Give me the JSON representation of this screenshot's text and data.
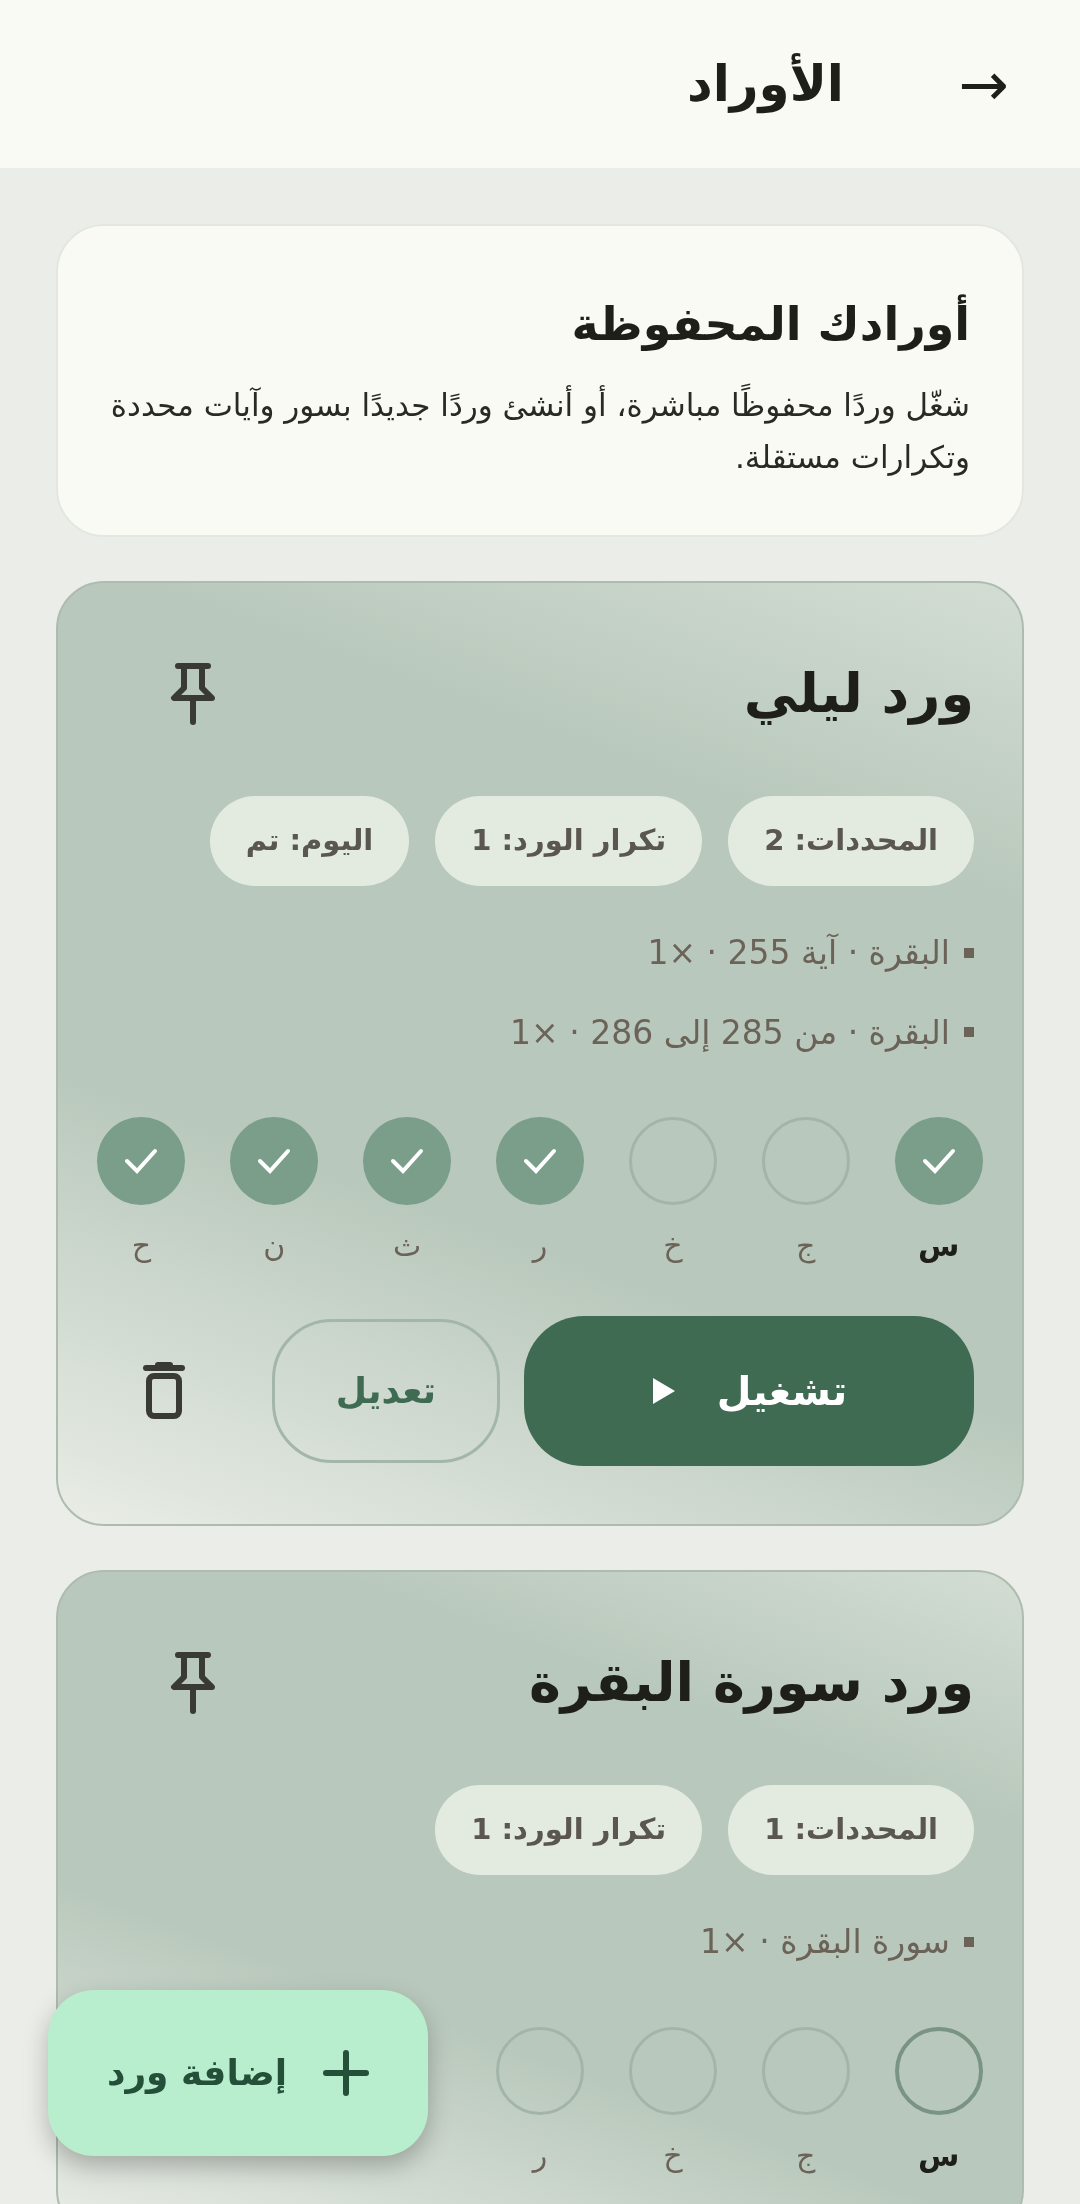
{
  "header": {
    "title": "الأوراد",
    "back": "→"
  },
  "intro": {
    "title": "أورادك المحفوظة",
    "text": "شغّل وردًا محفوظًا مباشرة، أو أنشئ وردًا جديدًا بسور وآيات محددة وتكرارات مستقلة."
  },
  "wirds": [
    {
      "title": "ورد ليلي",
      "pinned": false,
      "chips": [
        "المحددات: 2",
        "تكرار الورد: 1",
        "اليوم: تم"
      ],
      "items": [
        "البقرة · آية 255 · ×1",
        "البقرة · من 285 إلى 286 · ×1"
      ],
      "days": [
        {
          "label": "س",
          "done": true,
          "today": true
        },
        {
          "label": "ج",
          "done": false,
          "today": false
        },
        {
          "label": "خ",
          "done": false,
          "today": false
        },
        {
          "label": "ر",
          "done": true,
          "today": false
        },
        {
          "label": "ث",
          "done": true,
          "today": false
        },
        {
          "label": "ن",
          "done": true,
          "today": false
        },
        {
          "label": "ح",
          "done": true,
          "today": false
        }
      ],
      "actions": {
        "play": "تشغيل",
        "edit": "تعديل"
      }
    },
    {
      "title": "ورد سورة البقرة",
      "pinned": false,
      "chips": [
        "المحددات: 1",
        "تكرار الورد: 1"
      ],
      "items": [
        "سورة البقرة · ×1"
      ],
      "days": [
        {
          "label": "س",
          "done": false,
          "today": true
        },
        {
          "label": "ج",
          "done": false,
          "today": false
        },
        {
          "label": "خ",
          "done": false,
          "today": false
        },
        {
          "label": "ر",
          "done": false,
          "today": false
        }
      ]
    }
  ],
  "fab": {
    "label": "إضافة ورد"
  }
}
